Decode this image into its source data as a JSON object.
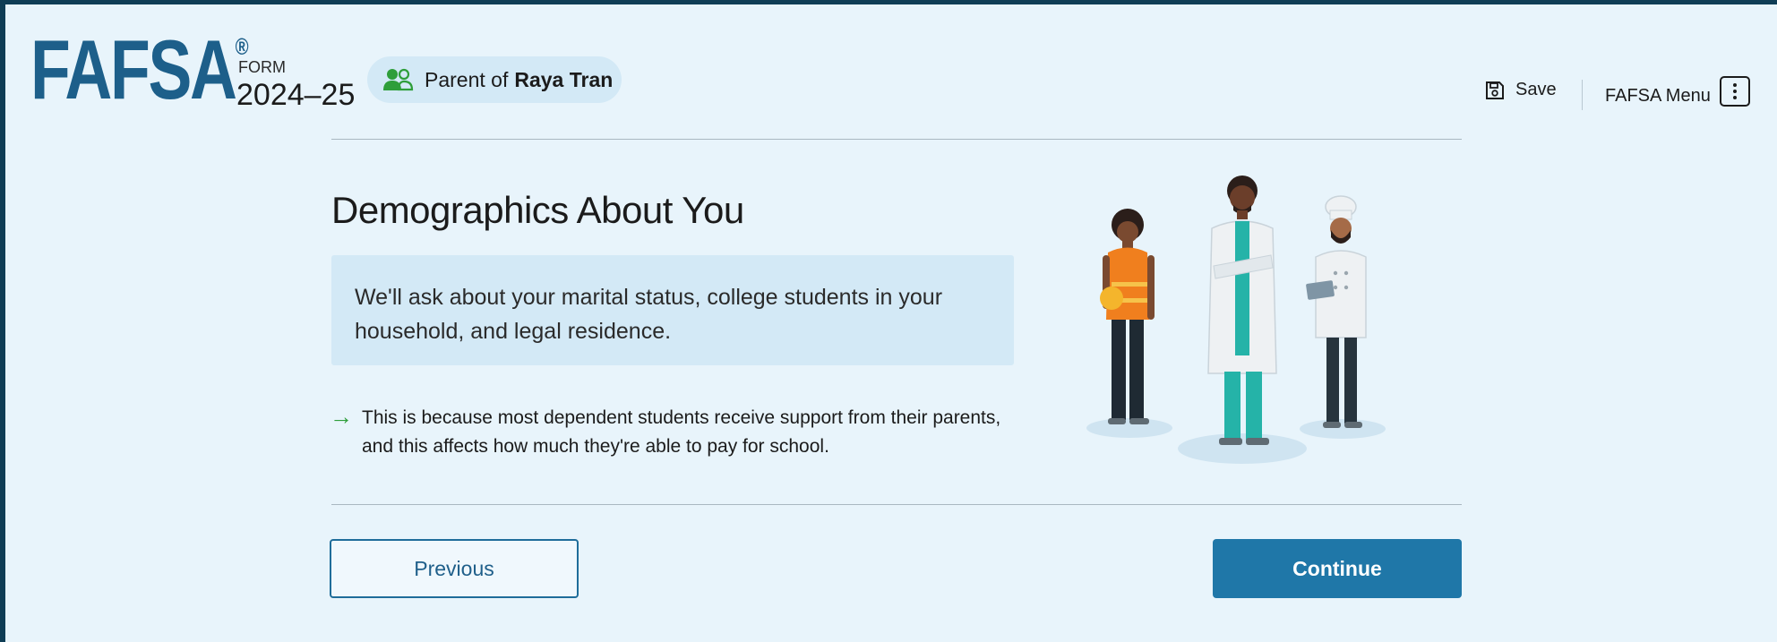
{
  "header": {
    "logo_text": "FAFSA",
    "logo_mark": "®",
    "form_label": "FORM",
    "form_year": "2024–25",
    "role_prefix": "Parent of",
    "student_name": "Raya Tran",
    "role_icon": "users-icon",
    "save_label": "Save",
    "save_icon": "floppy-disk-icon",
    "menu_label": "FAFSA Menu",
    "menu_icon": "kebab-icon"
  },
  "main": {
    "title": "Demographics About You",
    "info_text": "We'll ask about your marital status, college students in your household, and legal residence.",
    "reason_text": "This is because most dependent students receive support from their parents, and this affects how much they're able to pay for school.",
    "reason_icon": "arrow-right-icon"
  },
  "footer": {
    "previous_label": "Previous",
    "continue_label": "Continue"
  },
  "colors": {
    "brand": "#1d5f8a",
    "background": "#e8f4fb",
    "info_box": "#d3e9f6",
    "primary_button": "#1f77a8",
    "accent_green": "#2e9e3a"
  }
}
